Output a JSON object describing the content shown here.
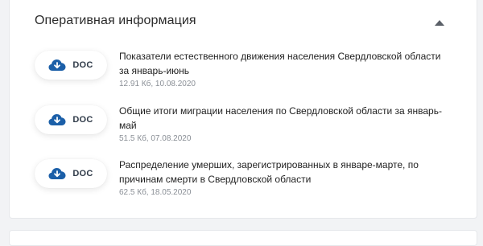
{
  "panel": {
    "title": "Оперативная информация",
    "toggle_icon": "chevron-up-icon",
    "accent_color": "#1b5fa8"
  },
  "documents": [
    {
      "format": "DOC",
      "icon": "cloud-download-icon",
      "title_line1": "Показатели естественного движения населения Свердловской области",
      "title_line2": "за январь-июнь",
      "meta": "12.91 Кб, 10.08.2020"
    },
    {
      "format": "DOC",
      "icon": "cloud-download-icon",
      "title_line1": "Общие итоги миграции населения по Свердловской области за январь-",
      "title_line2": "май",
      "meta": "51.5 Кб, 07.08.2020"
    },
    {
      "format": "DOC",
      "icon": "cloud-download-icon",
      "title_line1": "Распределение умерших, зарегистрированных в январе-марте, по",
      "title_line2": "причинам смерти в Свердловской области",
      "meta": "62.5 Кб, 18.05.2020"
    }
  ]
}
